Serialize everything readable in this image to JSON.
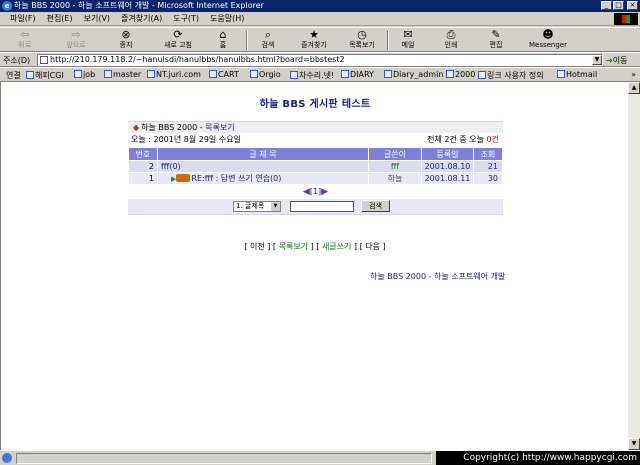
{
  "window": {
    "title": "하늘 BBS 2000 - 하늘 소프트웨어 개발 - Microsoft Internet Explorer",
    "controls": [
      "_",
      "□",
      "×"
    ]
  },
  "menu": [
    "파일(F)",
    "편집(E)",
    "보기(V)",
    "즐겨찾기(A)",
    "도구(T)",
    "도움말(H)"
  ],
  "toolbar": {
    "back": "뒤로",
    "forward": "앞으로",
    "stop": "중지",
    "refresh": "새로 고침",
    "home": "홈",
    "search": "검색",
    "favorites": "즐겨찾기",
    "history": "목록보기",
    "mail": "메일",
    "print": "인쇄",
    "edit": "편집",
    "messenger": "Messenger"
  },
  "address": {
    "label": "주소(D)",
    "url": "http://210.179.118.2/~hanulsdi/hanulbbs/hanulbbs.html?board=bbstest2",
    "go": "이동"
  },
  "links": {
    "label": "연결",
    "items": [
      "해피CGI",
      "job",
      "master",
      "NT.juri.com",
      "CART",
      "Orgio",
      "차수리.넷!",
      "DIARY",
      "Diary_admin",
      "2000",
      "링크 사용자 정의",
      "Hotmail"
    ],
    "more": "»"
  },
  "page": {
    "title": "하늘 BBS 게시판 테스트",
    "breadcrumb_board": "하늘 BBS 2000 - ",
    "breadcrumb_view": "목록보기",
    "date_text": "오늘 : 2001년 8월 29일 수요일",
    "stats_prefix": "전체 ",
    "stats_total": "2건",
    "stats_mid": " 중 오늘 ",
    "stats_today": "0건",
    "columns": {
      "num": "번호",
      "subject": "글 제 목",
      "author": "글쓴이",
      "date": "등록일",
      "hits": "조회"
    },
    "rows": [
      {
        "num": "2",
        "subject": "fff(0)",
        "author": "fff",
        "date": "2001.08.10",
        "hits": "21"
      },
      {
        "num": "1",
        "subject": "RE:fff : 답변 쓰기 연습(0)",
        "author": "하늘",
        "date": "2001.08.11",
        "hits": "30"
      }
    ],
    "pager": "[1]",
    "search_field": "1. 글제목",
    "search_button": "검색",
    "nav": {
      "prev": "[ 이전 ]",
      "list": "목록보기",
      "write": "새글쓰기",
      "next": "[ 다음 ]",
      "bracket_open": "[ ",
      "bracket_close": " ]"
    },
    "credit": "하늘 BBS 2000 - 하늘 소프트웨어 개발"
  },
  "copyright": "Copyright(c) http://www.happycgi.com",
  "colors": {
    "header_bg": "#8080d8",
    "row_bg": "#dcdcf0",
    "title_color": "#1a1a80",
    "author_color": "#1a6a1a"
  }
}
